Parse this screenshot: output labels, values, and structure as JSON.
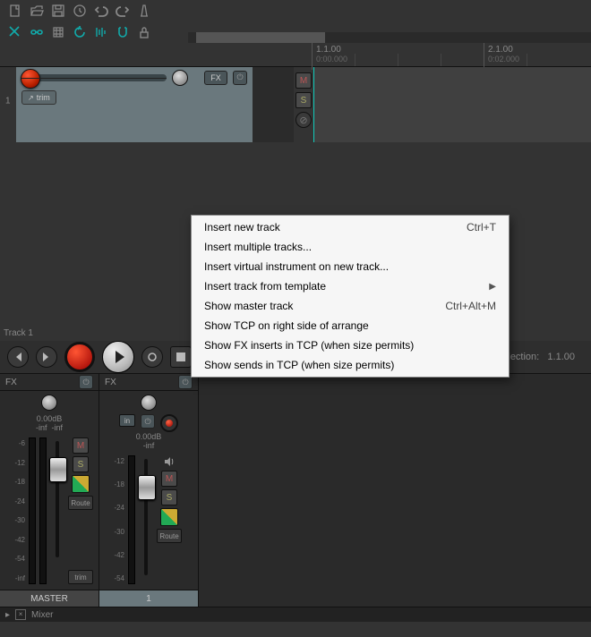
{
  "toolbar": {},
  "ruler": {
    "mark1": {
      "beat": "1.1.00",
      "time": "0:00.000"
    },
    "mark2": {
      "beat": "2.1.00",
      "time": "0:02.000"
    }
  },
  "track1": {
    "index": "1",
    "name": "Track 1",
    "trim_label": "trim",
    "fx_label": "FX",
    "mute": "M",
    "solo": "S"
  },
  "transport": {
    "selection_label": "lection:",
    "selection_value": "1.1.00"
  },
  "context_menu": {
    "items": [
      {
        "label": "Insert new track",
        "shortcut": "Ctrl+T",
        "sub": false
      },
      {
        "label": "Insert multiple tracks...",
        "shortcut": "",
        "sub": false
      },
      {
        "label": "Insert virtual instrument on new track...",
        "shortcut": "",
        "sub": false
      },
      {
        "label": "Insert track from template",
        "shortcut": "",
        "sub": true
      },
      {
        "label": "Show master track",
        "shortcut": "Ctrl+Alt+M",
        "sub": false
      },
      {
        "label": "Show TCP on right side of arrange",
        "shortcut": "",
        "sub": false
      },
      {
        "label": "Show FX inserts in TCP (when size permits)",
        "shortcut": "",
        "sub": false
      },
      {
        "label": "Show sends in TCP (when size permits)",
        "shortcut": "",
        "sub": false
      }
    ]
  },
  "mixer": {
    "master": {
      "fx_label": "FX",
      "db_label": "0.00dB",
      "peak_l": "-inf",
      "peak_r": "-inf",
      "scale": [
        "-6",
        "-12",
        "-18",
        "-24",
        "-30",
        "-42",
        "-54",
        "-inf"
      ],
      "scale2": [
        "-6",
        "-12",
        "-18",
        "-24",
        "-30",
        "-42",
        "-54",
        "-inf"
      ],
      "name": "MASTER",
      "mute": "M",
      "solo": "S",
      "route_label": "Route",
      "trim_label": "trim"
    },
    "track1": {
      "fx_label": "FX",
      "in_label": "in",
      "db_label": "0.00dB",
      "peak": "-inf",
      "scale": [
        "-12",
        "-18",
        "-24",
        "-30",
        "-42",
        "-54"
      ],
      "name": "1",
      "mute": "M",
      "solo": "S",
      "route_label": "Route"
    }
  },
  "bottom": {
    "mixer_label": "Mixer"
  }
}
